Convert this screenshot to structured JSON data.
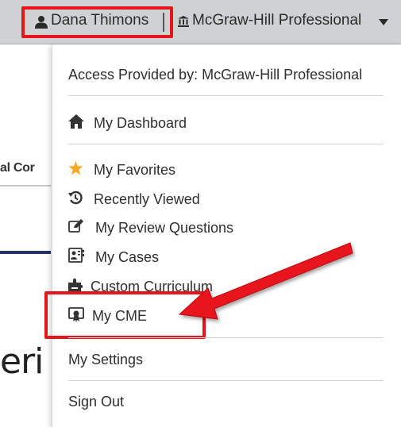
{
  "background": {
    "tab_fragment": "al Cor",
    "heading_fragment": "eri"
  },
  "topbar": {
    "user_name": "Dana Thimons",
    "org_name": "McGraw-Hill Professional"
  },
  "menu": {
    "access_text": "Access Provided by: McGraw-Hill Professional",
    "items": [
      {
        "label": "My Dashboard",
        "icon": "home-icon"
      },
      {
        "label": "My Favorites",
        "icon": "star-icon"
      },
      {
        "label": "Recently Viewed",
        "icon": "history-icon"
      },
      {
        "label": "My Review Questions",
        "icon": "edit-icon"
      },
      {
        "label": "My Cases",
        "icon": "case-icon"
      },
      {
        "label": "Custom Curriculum",
        "icon": "puzzle-icon"
      },
      {
        "label": "My CME",
        "icon": "certificate-icon"
      },
      {
        "label": "My Settings",
        "icon": ""
      },
      {
        "label": "Sign Out",
        "icon": ""
      }
    ]
  },
  "colors": {
    "highlight_red": "#e8141b",
    "star_orange": "#f5a623",
    "topbar_gray": "#cfd1d3",
    "rule_navy": "#26326b"
  }
}
